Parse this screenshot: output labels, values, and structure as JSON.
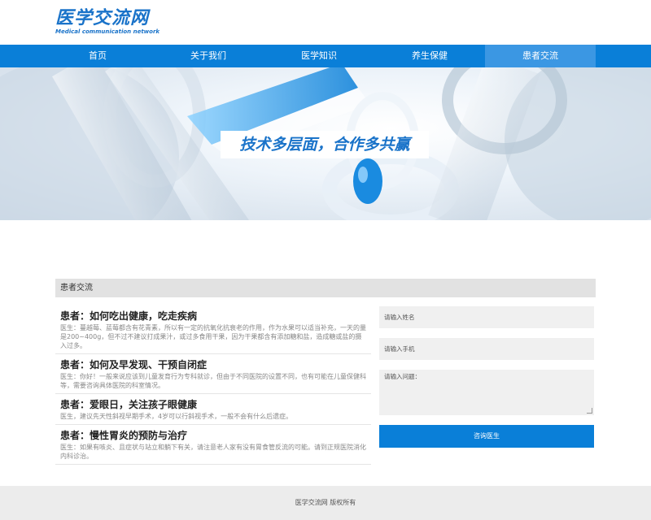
{
  "logo": {
    "cn": "医学交流网",
    "en": "Medical communication network"
  },
  "nav": {
    "items": [
      "首页",
      "关于我们",
      "医学知识",
      "养生保健",
      "患者交流"
    ],
    "active_index": 4
  },
  "banner": {
    "slogan": "技术多层面，合作多共赢"
  },
  "section": {
    "title": "患者交流"
  },
  "posts": [
    {
      "title": "患者：如何吃出健康，吃走疾病",
      "body": "医生：蔓越莓、蓝莓都含有花青素，所以有一定的抗氧化抗衰老的作用，作为水果可以适当补充，一天的量是200~400g，但不过不建议打成果汁，或过多食用干果，因为干果都含有添加糖和盐，造成糖或盐的摄入过多。"
    },
    {
      "title": "患者：如何及早发现、干预自闭症",
      "body": "医生：你好！一般来说应该到儿童发育行为专科就诊，但由于不同医院的设置不同，也有可能在儿童保健科等，需要咨询具体医院的科室情况。"
    },
    {
      "title": "患者：爱眼日，关注孩子眼健康",
      "body": "医生，建议先天性斜视早期手术，4岁可以行斜视手术，一般不会有什么后遗症。"
    },
    {
      "title": "患者：慢性胃炎的预防与治疗",
      "body": "医生：如果有咳炎、且症状与站立和躺下有关，请注意老人家有没有胃食管反流的可能。请到正规医院消化内科诊治。"
    }
  ],
  "form": {
    "name_placeholder": "请输入姓名",
    "phone_placeholder": "请输入手机",
    "question_placeholder": "请输入问题：",
    "submit_label": "咨询医生"
  },
  "footer": {
    "text": "医学交流网 版权所有"
  },
  "colors": {
    "brand": "#0a7fd8",
    "nav_active": "#3b97e3"
  }
}
